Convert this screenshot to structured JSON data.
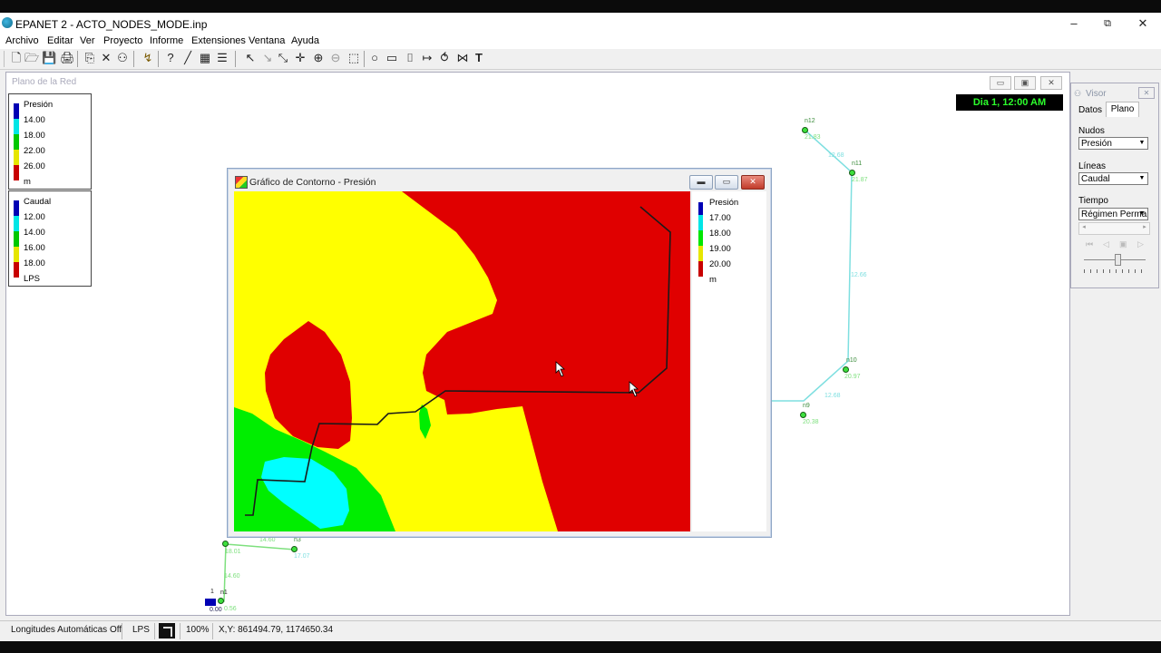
{
  "app": {
    "title": "EPANET 2 - ACTO_NODES_MODE.inp",
    "window_controls": {
      "minimize": "–",
      "maximize": "⧉",
      "close": "✕"
    }
  },
  "menu": [
    "Archivo",
    "Editar",
    "Ver",
    "Proyecto",
    "Informe",
    "Extensiones",
    "Ventana",
    "Ayuda"
  ],
  "toolbar": {
    "icons": [
      "new-file-icon",
      "open-folder-icon",
      "save-icon",
      "print-icon",
      "copy-icon",
      "delete-icon",
      "find-icon",
      "run-icon",
      "query-icon",
      "graph-icon",
      "table-icon",
      "options-icon",
      "select-arrow-icon",
      "select-vertex-icon",
      "select-region-icon",
      "pan-icon",
      "zoom-in-icon",
      "zoom-out-icon",
      "full-extent-icon",
      "add-junction-icon",
      "add-reservoir-icon",
      "add-tank-icon",
      "add-pipe-icon",
      "add-pump-icon",
      "add-valve-icon",
      "add-label-icon"
    ],
    "glyphs": [
      "🗋",
      "🗁",
      "💾",
      "🖨",
      "⎘",
      "✕",
      "⚇",
      "↯",
      "?",
      "╱",
      "▦",
      "☰",
      "↖",
      "↘",
      "⤡",
      "✛",
      "⊕",
      "⊖",
      "⬚",
      "○",
      "▭",
      "⌷",
      "↦",
      "⥀",
      "⋈",
      "T"
    ]
  },
  "map": {
    "title": "Plano de la Red",
    "time_label": "Dia 1, 12:00 AM",
    "node_legend": {
      "title": "Presión",
      "values": [
        "14.00",
        "18.00",
        "22.00",
        "26.00"
      ],
      "unit": "m",
      "colors": [
        "#0000b4",
        "#00e6e6",
        "#00c800",
        "#e6e600",
        "#c80000"
      ]
    },
    "link_legend": {
      "title": "Caudal",
      "values": [
        "12.00",
        "14.00",
        "16.00",
        "18.00"
      ],
      "unit": "LPS",
      "colors": [
        "#0000b4",
        "#00e6e6",
        "#00c800",
        "#e6e600",
        "#c80000"
      ]
    },
    "labels": {
      "n12": "n12",
      "n12_val": "21.83",
      "p1_val": "12.68",
      "n11": "n11",
      "n11_val": "21.87",
      "p2_val": "12.66",
      "n10": "n10",
      "n10_val": "20.97",
      "p3_val": "12.68",
      "n9": "n9",
      "n9_val": "20.38",
      "p4_val": "14.60",
      "n3": "n3",
      "n3_val": "17.07",
      "n2_val": "18.01",
      "p5_val": "14.60",
      "r1": "1",
      "r1_val": "0.00",
      "n1": "n1",
      "n1_val": "0.56"
    }
  },
  "contour": {
    "title": "Gráfico de Contorno - Presión",
    "legend": {
      "title": "Presión",
      "values": [
        "17.00",
        "18.00",
        "19.00",
        "20.00"
      ],
      "unit": "m",
      "colors": [
        "#0000b4",
        "#00e6e6",
        "#00e600",
        "#e6e600",
        "#c80000"
      ]
    },
    "palette": {
      "red": "#e00000",
      "yellow": "#ffff00",
      "green": "#00ee00",
      "cyan": "#00ffff"
    }
  },
  "visor": {
    "title": "Visor",
    "tabs": [
      "Datos",
      "Plano"
    ],
    "nodes_label": "Nudos",
    "nodes_value": "Presión",
    "links_label": "Líneas",
    "links_value": "Caudal",
    "time_label": "Tiempo",
    "time_value": "Régimen Perma"
  },
  "status": {
    "auto_length": "Longitudes Automáticas Off",
    "flow_units": "LPS",
    "zoom": "100%",
    "coords": "X,Y: 861494.79, 1174650.34"
  }
}
